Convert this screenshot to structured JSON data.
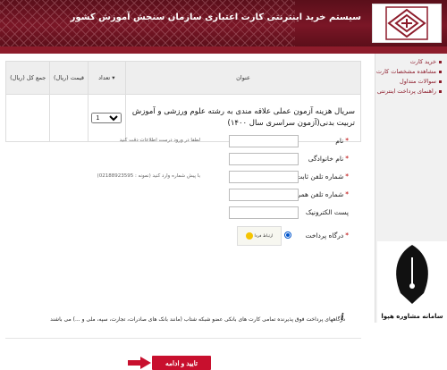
{
  "header": {
    "title": "سیستم خرید اینترنتی کارت اعتباری سازمان سنجش آموزش کشور"
  },
  "sidebar": {
    "items": [
      {
        "label": "خرید کارت"
      },
      {
        "label": "مشاهده مشخصات کارت"
      },
      {
        "label": "سوالات متداول"
      },
      {
        "label": "راهنمای پرداخت اینترنتی"
      }
    ]
  },
  "table": {
    "headers": {
      "title": "عنوان",
      "qty": "تعداد",
      "price": "قیمت (ریال)",
      "total": "جمع کل (ریال)"
    },
    "rows": [
      {
        "title": "سریال هزینه آزمون عملی علاقه مندی به رشته علوم ورزشی و آموزش تربیت بدنی(آزمون سراسری سال ۱۴۰۰)",
        "qty": "1",
        "price": "",
        "total": ""
      }
    ]
  },
  "form": {
    "first_name": {
      "label": "نام",
      "hint": "لطفا در ورود درست اطلاعات دقت کنید"
    },
    "last_name": {
      "label": "نام خانوادگی"
    },
    "phone": {
      "label": "شماره تلفن ثابت",
      "hint": "با پیش شماره وارد کنید (نمونه : 02188923595)"
    },
    "mobile": {
      "label": "شماره تلفن همراه"
    },
    "email": {
      "label": "پست الکترونیک"
    },
    "gateway": {
      "label": "درگاه پرداخت",
      "logo_text": "ارتباط فردا"
    }
  },
  "note": "درگاههای پرداخت فوق پذیرنده تمامی کارت های بانکی عضو شبکه شتاب (مانند بانک های صادرات، تجارت، سپه، ملی و ...) می باشند",
  "submit_label": "تایید و ادامه",
  "watermark": "سامانه مشاوره هپوا",
  "colors": {
    "brand": "#8d1c2b",
    "button": "#c8102e"
  }
}
